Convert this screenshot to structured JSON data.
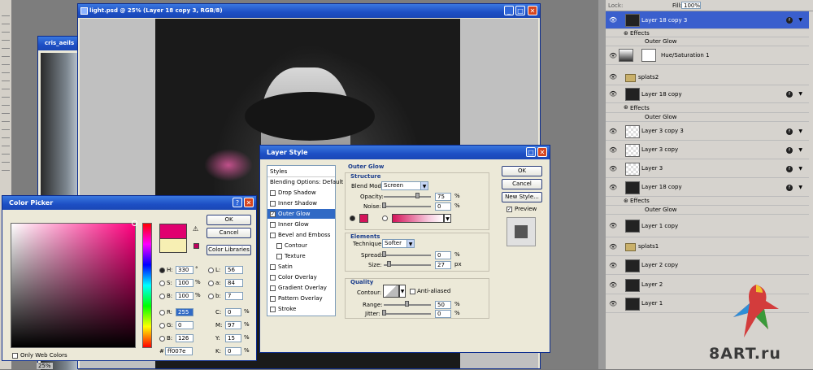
{
  "document": {
    "title": "light.psd @ 25% (Layer 18 copy 3, RGB/8)"
  },
  "background_doc": {
    "title": "cris_aeils"
  },
  "color_picker": {
    "title": "Color Picker",
    "ok": "OK",
    "cancel": "Cancel",
    "libraries": "Color Libraries",
    "only_web": "Only Web Colors",
    "fields": [
      {
        "label": "H:",
        "value": "330",
        "unit": "°"
      },
      {
        "label": "S:",
        "value": "100",
        "unit": "%"
      },
      {
        "label": "B:",
        "value": "100",
        "unit": "%"
      },
      {
        "label": "R:",
        "value": "255",
        "unit": ""
      },
      {
        "label": "G:",
        "value": "0",
        "unit": ""
      },
      {
        "label": "B:",
        "value": "126",
        "unit": ""
      }
    ],
    "lab_fields": [
      {
        "label": "L:",
        "value": "56"
      },
      {
        "label": "a:",
        "value": "84"
      },
      {
        "label": "b:",
        "value": "7"
      }
    ],
    "cmyk_fields": [
      {
        "label": "C:",
        "value": "0",
        "unit": "%"
      },
      {
        "label": "M:",
        "value": "97",
        "unit": "%"
      },
      {
        "label": "Y:",
        "value": "15",
        "unit": "%"
      },
      {
        "label": "K:",
        "value": "0",
        "unit": "%"
      }
    ],
    "hex_label": "#",
    "hex": "ff007e",
    "new_color": "#e0006f",
    "old_color": "#f7efb3"
  },
  "layer_style": {
    "title": "Layer Style",
    "list": [
      "Styles",
      "Blending Options: Default",
      "Drop Shadow",
      "Inner Shadow",
      "Outer Glow",
      "Inner Glow",
      "Bevel and Emboss",
      "Contour",
      "Texture",
      "Satin",
      "Color Overlay",
      "Gradient Overlay",
      "Pattern Overlay",
      "Stroke"
    ],
    "section_title": "Outer Glow",
    "structure": "Structure",
    "blend_mode_label": "Blend Mode:",
    "blend_mode": "Screen",
    "opacity_label": "Opacity:",
    "opacity": "75",
    "noise_label": "Noise:",
    "noise": "0",
    "elements": "Elements",
    "technique_label": "Technique:",
    "technique": "Softer",
    "spread_label": "Spread:",
    "spread": "0",
    "size_label": "Size:",
    "size": "27",
    "size_unit": "px",
    "quality": "Quality",
    "contour_label": "Contour:",
    "anti_aliased": "Anti-aliased",
    "range_label": "Range:",
    "range": "50",
    "jitter_label": "Jitter:",
    "jitter": "0",
    "percent": "%",
    "ok": "OK",
    "cancel": "Cancel",
    "new_style": "New Style...",
    "preview": "Preview",
    "glow_color": "#d4145a"
  },
  "layers_panel": {
    "lock_label": "Lock:",
    "fill_label": "Fill:",
    "fill_value": "100%",
    "rows": [
      {
        "name": "Layer 18 copy 3",
        "kind": "layer",
        "selected": true
      },
      {
        "name": "Effects",
        "kind": "effects"
      },
      {
        "name": "Outer Glow",
        "kind": "effect"
      },
      {
        "name": "Hue/Saturation 1",
        "kind": "adjust"
      },
      {
        "name": "splats2",
        "kind": "group"
      },
      {
        "name": "Layer 18 copy",
        "kind": "layer"
      },
      {
        "name": "Effects",
        "kind": "effects"
      },
      {
        "name": "Outer Glow",
        "kind": "effect"
      },
      {
        "name": "Layer 3 copy 3",
        "kind": "layer"
      },
      {
        "name": "Layer 3 copy",
        "kind": "layer"
      },
      {
        "name": "Layer 3",
        "kind": "layer"
      },
      {
        "name": "Layer 18 copy",
        "kind": "layer"
      },
      {
        "name": "Effects",
        "kind": "effects"
      },
      {
        "name": "Outer Glow",
        "kind": "effect"
      },
      {
        "name": "Layer 1 copy",
        "kind": "layer"
      },
      {
        "name": "splats1",
        "kind": "group"
      },
      {
        "name": "Layer 2 copy",
        "kind": "layer"
      },
      {
        "name": "Layer 2",
        "kind": "layer"
      },
      {
        "name": "Layer 1",
        "kind": "layer"
      }
    ]
  },
  "watermark": {
    "text": "8ART.ru"
  },
  "status": {
    "zoom": "25%"
  }
}
